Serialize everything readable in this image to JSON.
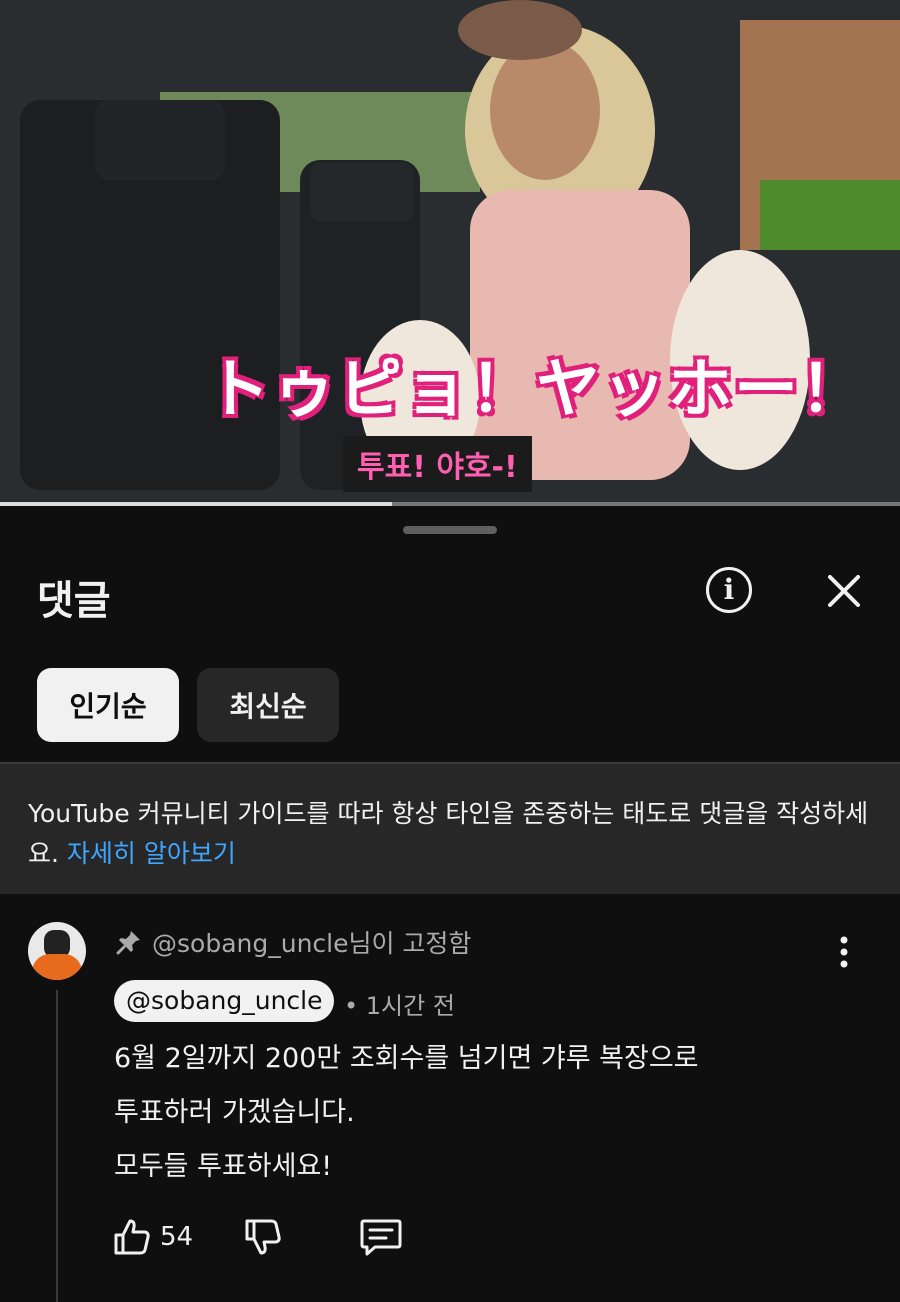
{
  "video": {
    "caption_japanese": "トゥピョ！ヤッホー！",
    "caption_korean": "투표! 야호-!",
    "progress": 0.435
  },
  "comments_sheet": {
    "title": "댓글",
    "info_icon": "info-icon",
    "close_icon": "close-icon",
    "sort_chips": [
      {
        "label": "인기순",
        "active": true
      },
      {
        "label": "최신순",
        "active": false
      }
    ],
    "guideline": {
      "text": "YouTube 커뮤니티 가이드를 따라 항상 타인을 존중하는 태도로 댓글을 작성하세요.",
      "link": "자세히 알아보기"
    }
  },
  "pinned_comment": {
    "pinned_by": "@sobang_uncle님이 고정함",
    "author": "@sobang_uncle",
    "time": "• 1시간 전",
    "lines": [
      "6월 2일까지 200만 조회수를 넘기면 갸루 복장으로",
      "투표하러 가겠습니다.",
      "모두들 투표하세요!"
    ],
    "likes": "54"
  }
}
